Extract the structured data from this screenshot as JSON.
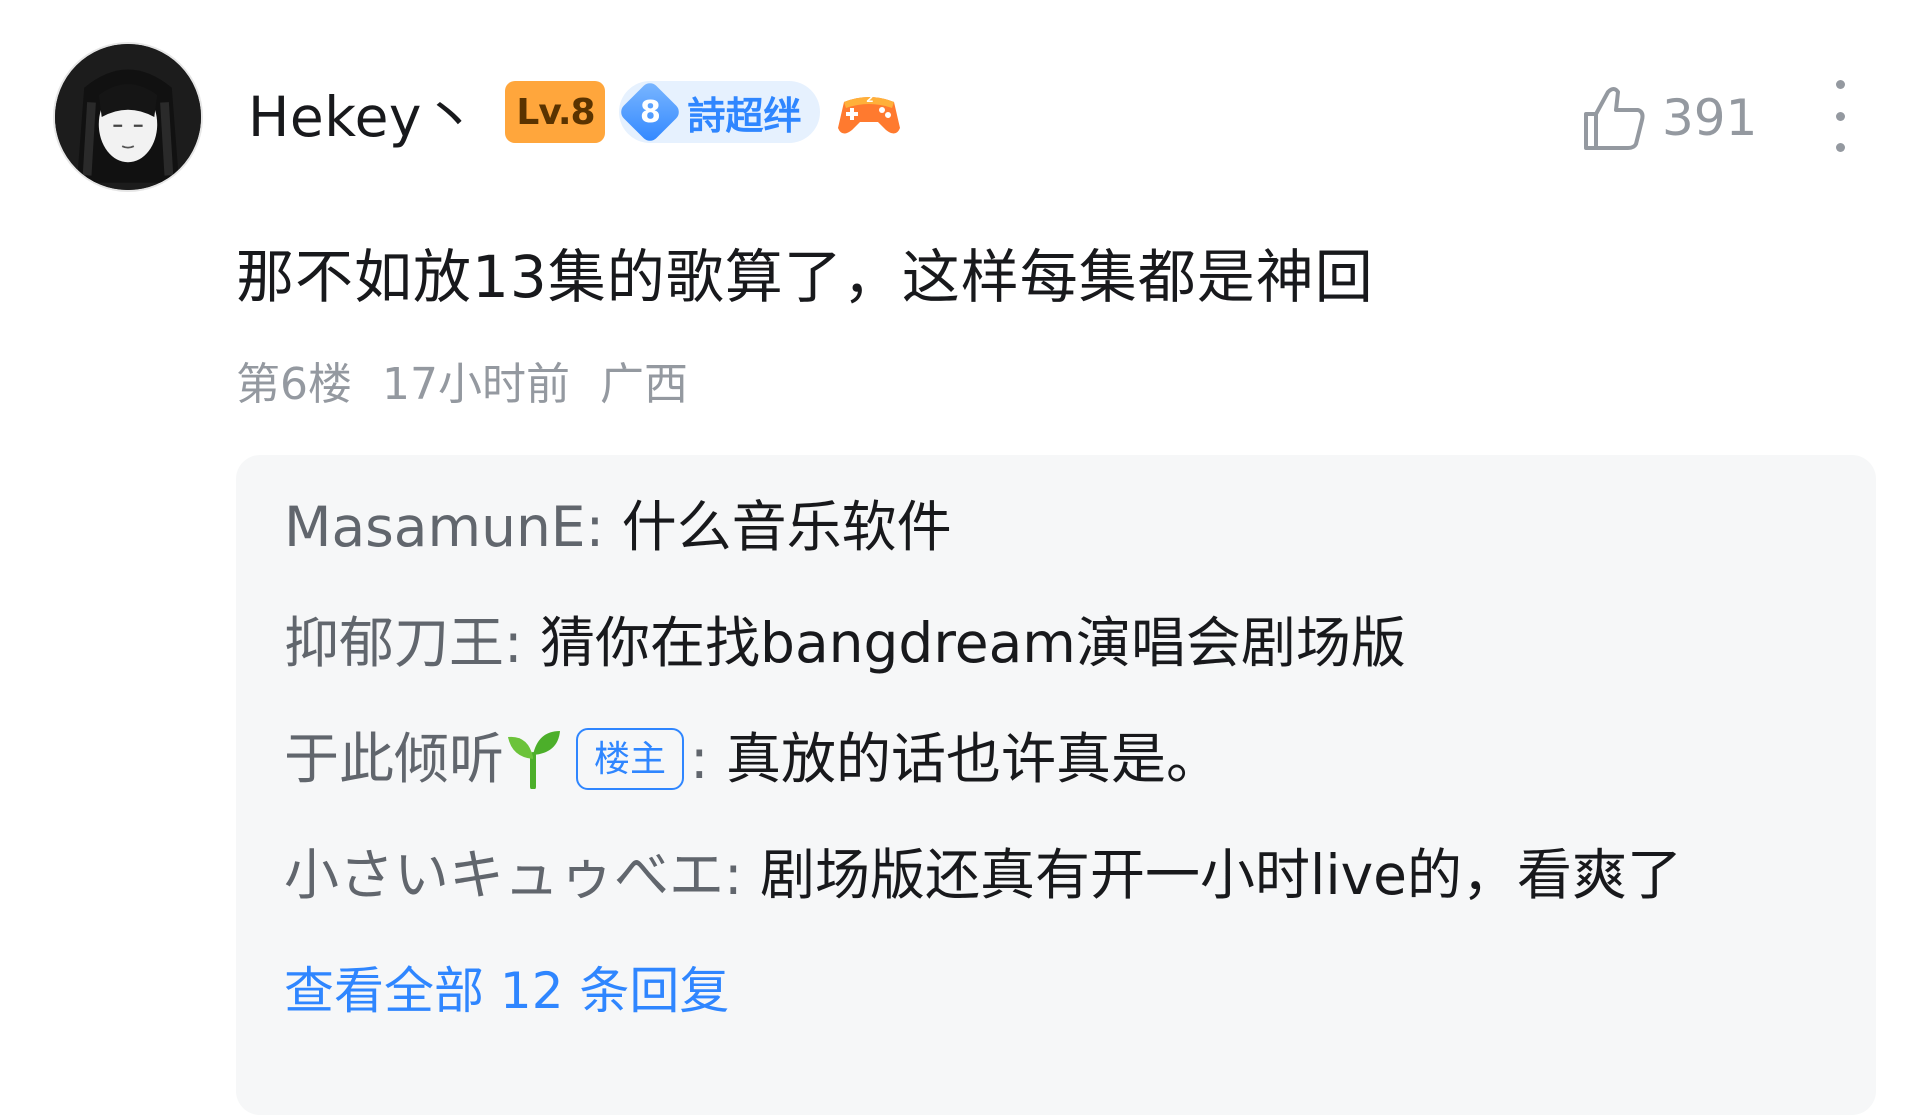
{
  "comment": {
    "user": {
      "name": "Hekey丶",
      "level": "Lv.8",
      "fan_medal_level": "8",
      "fan_medal_name": "詩超绊"
    },
    "likes": "391",
    "text": "那不如放13集的歌算了，这样每集都是神回",
    "floor": "第6楼",
    "time": "17小时前",
    "location": "广西",
    "colors": {
      "accent_blue": "#2f86ff",
      "level_orange": "#ffa63c",
      "meta_gray": "#9499a0",
      "reply_bg": "#f6f7f8"
    }
  },
  "replies": [
    {
      "name": "MasamunE",
      "colon": ":",
      "text": "什么音乐软件"
    },
    {
      "name": "抑郁刀王",
      "colon": ":",
      "text": "猜你在找bangdream演唱会剧场版"
    },
    {
      "name": "于此倾听",
      "badge": "楼主",
      "colon": ":",
      "text": "真放的话也许真是。"
    },
    {
      "name": "小さいキュゥべエ",
      "colon": ":",
      "text": "剧场版还真有开一小时live的，看爽了"
    }
  ],
  "view_more": "查看全部 12 条回复",
  "icons": {
    "like": "thumbs-up-icon",
    "more": "more-vertical-icon",
    "game": "game-controller-icon",
    "sprout": "sprout-icon"
  }
}
